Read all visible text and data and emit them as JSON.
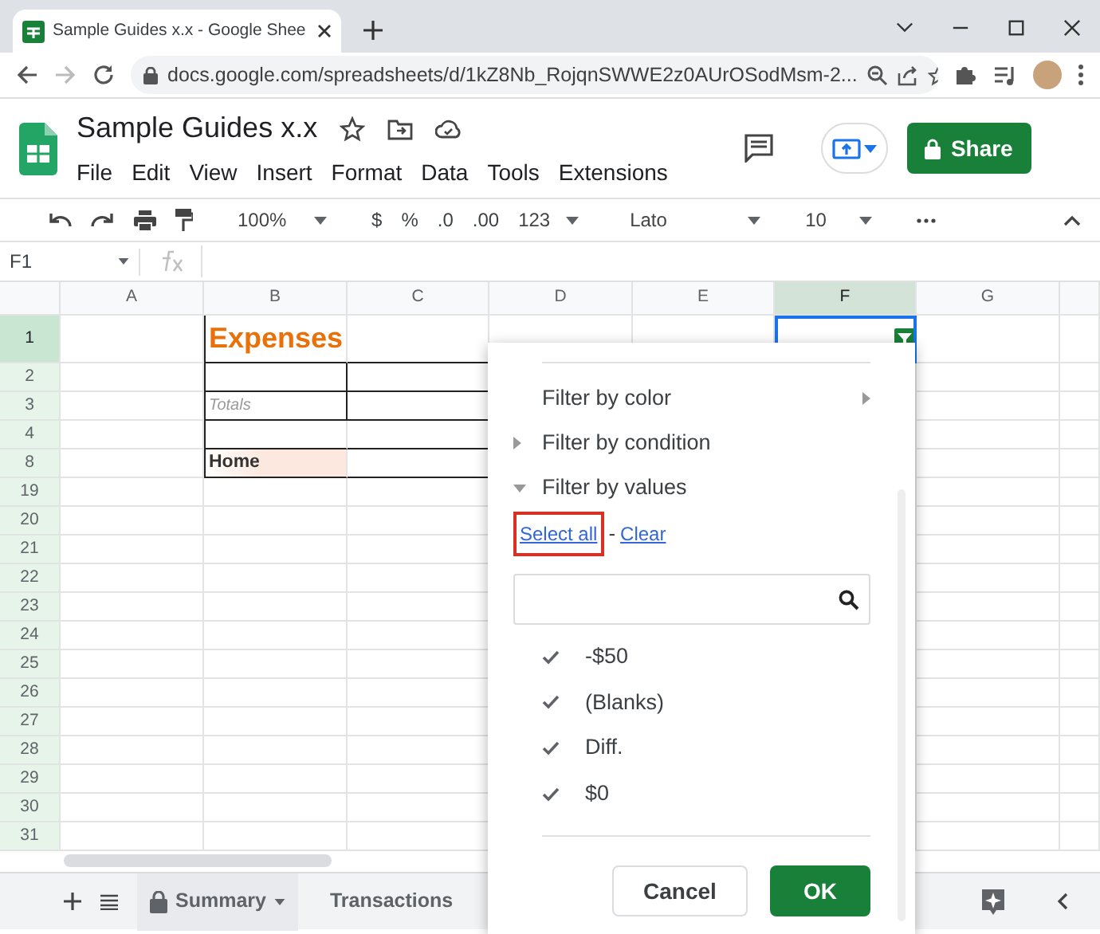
{
  "browser": {
    "tab_title": "Sample Guides x.x - Google Shee",
    "url": "docs.google.com/spreadsheets/d/1kZ8Nb_RojqnSWWE2z0AUrOSodMsm-2..."
  },
  "doc": {
    "title": "Sample Guides x.x",
    "menu": [
      "File",
      "Edit",
      "View",
      "Insert",
      "Format",
      "Data",
      "Tools",
      "Extensions"
    ],
    "share_label": "Share"
  },
  "toolbar": {
    "zoom": "100%",
    "format_items": [
      "$",
      "%",
      ".0",
      ".00",
      "123"
    ],
    "font": "Lato",
    "font_size": "10"
  },
  "formula_bar": {
    "cell_ref": "F1"
  },
  "grid": {
    "columns": [
      {
        "label": "A",
        "selected": false
      },
      {
        "label": "B",
        "selected": false
      },
      {
        "label": "C",
        "selected": false
      },
      {
        "label": "D",
        "selected": false
      },
      {
        "label": "E",
        "selected": false
      },
      {
        "label": "F",
        "selected": true
      },
      {
        "label": "G",
        "selected": false
      }
    ],
    "rows": [
      {
        "label": "1",
        "selected": true
      },
      {
        "label": "2",
        "selected": false
      },
      {
        "label": "3",
        "selected": false
      },
      {
        "label": "4",
        "selected": false
      },
      {
        "label": "8",
        "selected": false
      },
      {
        "label": "19",
        "selected": false
      },
      {
        "label": "20",
        "selected": false
      },
      {
        "label": "21",
        "selected": false
      },
      {
        "label": "22",
        "selected": false
      },
      {
        "label": "23",
        "selected": false
      },
      {
        "label": "24",
        "selected": false
      },
      {
        "label": "25",
        "selected": false
      },
      {
        "label": "26",
        "selected": false
      },
      {
        "label": "27",
        "selected": false
      },
      {
        "label": "28",
        "selected": false
      },
      {
        "label": "29",
        "selected": false
      },
      {
        "label": "30",
        "selected": false
      },
      {
        "label": "31",
        "selected": false
      }
    ],
    "cells": {
      "B1": {
        "text": "Expenses",
        "kind": "title"
      },
      "B3": {
        "text": "Totals",
        "kind": "note"
      },
      "B8": {
        "text": "Home",
        "kind": "category"
      }
    }
  },
  "filter_menu": {
    "options": [
      {
        "label": "Filter by color",
        "kind": "submenu"
      },
      {
        "label": "Filter by condition",
        "kind": "collapsed"
      },
      {
        "label": "Filter by values",
        "kind": "expanded"
      }
    ],
    "select_all": "Select all",
    "separator": "-",
    "clear": "Clear",
    "select_all_highlighted": true,
    "values": [
      {
        "label": "-$50",
        "checked": true
      },
      {
        "label": "(Blanks)",
        "checked": true
      },
      {
        "label": "Diff.",
        "checked": true
      },
      {
        "label": "$0",
        "checked": true
      }
    ],
    "cancel": "Cancel",
    "ok": "OK"
  },
  "sheets": [
    {
      "label": "Summary",
      "locked": true,
      "selected": true
    },
    {
      "label": "Transactions",
      "locked": false,
      "selected": false
    }
  ]
}
